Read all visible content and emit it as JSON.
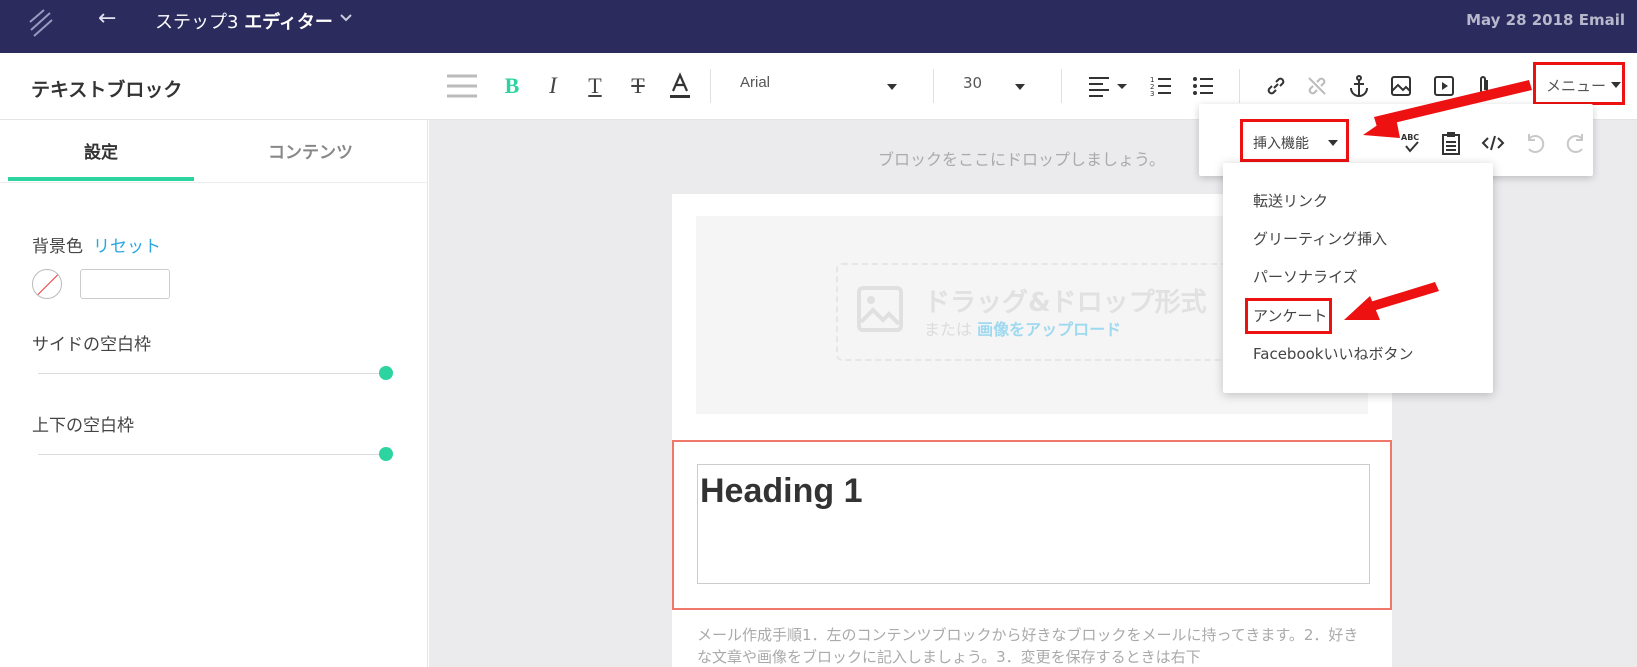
{
  "header": {
    "title_step": "ステップ3",
    "title_main": "エディター",
    "right_text": "May 28 2018 Email"
  },
  "toolbar": {
    "block_title": "テキストブロック",
    "font_family": "Arial",
    "font_size": "30",
    "menu_label": "メニュー"
  },
  "sidebar": {
    "tabs": [
      {
        "label": "設定",
        "active": true
      },
      {
        "label": "コンテンツ",
        "active": false
      }
    ],
    "bg_color_label": "背景色",
    "reset_label": "リセット",
    "side_padding_label": "サイドの空白枠",
    "vertical_padding_label": "上下の空白枠",
    "side_padding_value": 1.0,
    "vertical_padding_value": 1.0,
    "accent_color": "#2dd4a0"
  },
  "canvas": {
    "drop_hint": "ブロックをここにドロップしましょう。",
    "image_drop_title": "ドラッグ&ドロップ形式",
    "image_drop_or": "または",
    "image_drop_link": "画像をアップロード",
    "heading": "Heading 1",
    "body_text": "メール作成手順1．左のコンテンツブロックから好きなブロックをメールに持ってきます。2．好きな文章や画像をブロックに記入しましょう。3．変更を保存するときは右下"
  },
  "popover": {
    "insert_label": "挿入機能",
    "spellcheck_icon_text": "ABC"
  },
  "insert_menu": {
    "items": [
      "転送リンク",
      "グリーティング挿入",
      "パーソナライズ",
      "アンケート",
      "Facebookいいねボタン"
    ],
    "highlighted": "アンケート"
  },
  "colors": {
    "topbar": "#2b2b5e",
    "annotation_red": "#e11111",
    "link_blue": "#29a8e0"
  }
}
